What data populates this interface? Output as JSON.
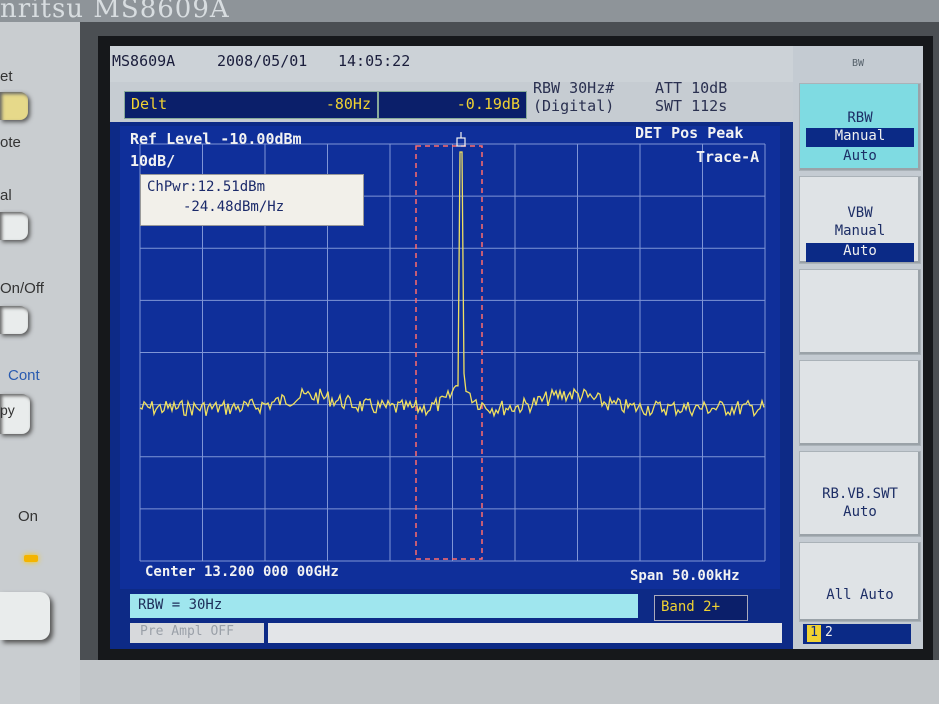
{
  "bezel": {
    "brand_partial": "nritsu  MS8609A"
  },
  "left_panel": {
    "labels": [
      "et",
      "ote",
      "al",
      "On/Off",
      "Cont",
      "py",
      "On"
    ]
  },
  "header": {
    "model": "MS8609A",
    "date": "2008/05/01",
    "time": "14:05:22"
  },
  "marker": {
    "mode_label": "Delt",
    "freq": "-80Hz",
    "level": "-0.19dB"
  },
  "settings": {
    "rbw": "RBW 30Hz#",
    "rbw_mode": "(Digital)",
    "att": "ATT 10dB",
    "swt": "SWT 112s"
  },
  "plot": {
    "ref_level": "Ref Level -10.00dBm",
    "scale": "10dB/",
    "det": "DET  Pos Peak",
    "trace": "Trace-A",
    "center": "Center 13.200 000 00GHz",
    "span": "Span 50.00kHz"
  },
  "chpwr": {
    "line1": "ChPwr:12.51dBm",
    "line2": "-24.48dBm/Hz"
  },
  "status": {
    "message": "RBW = 30Hz",
    "band": "Band 2+",
    "preamp": "Pre Ampl OFF"
  },
  "softkeys": {
    "menu_title": "BW",
    "rbw": {
      "title": "RBW",
      "opt1": "Manual",
      "opt2": "Auto"
    },
    "vbw": {
      "title": "VBW",
      "opt1": "Manual",
      "opt2": "Auto"
    },
    "rbvbswt": {
      "title": "RB.VB.SWT",
      "sub": "Auto"
    },
    "allauto": {
      "title": "All Auto"
    },
    "page": {
      "p1": "1",
      "p2": "2"
    }
  },
  "colors": {
    "screen_bg": "#0f2f9a",
    "trace": "#f0e060",
    "marker_window": "#ff6b6b",
    "accent_cyan": "#7fdbe2"
  }
}
